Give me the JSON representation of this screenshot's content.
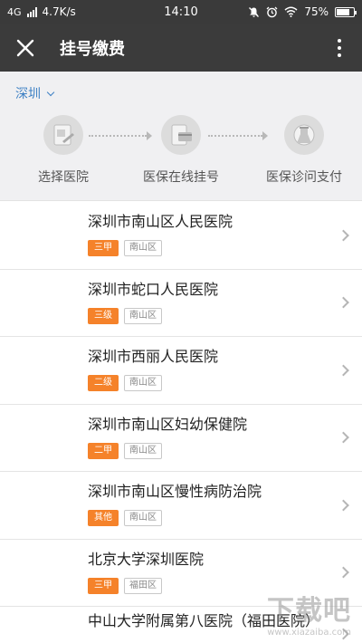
{
  "status": {
    "network": "4G",
    "speed": "4.7K/s",
    "time": "14:10",
    "battery": "75%",
    "battery_level": 0.75
  },
  "header": {
    "title": "挂号缴费",
    "close_icon": "close-icon",
    "more_icon": "more-vertical-icon"
  },
  "city": {
    "label": "深圳"
  },
  "steps": [
    {
      "label": "选择医院",
      "icon": "hospital-card-icon"
    },
    {
      "label": "医保在线挂号",
      "icon": "insurance-card-icon"
    },
    {
      "label": "医保诊问支付",
      "icon": "payment-flask-icon"
    }
  ],
  "hospitals": [
    {
      "name": "深圳市南山区人民医院",
      "level": "三甲",
      "district": "南山区"
    },
    {
      "name": "深圳市蛇口人民医院",
      "level": "三级",
      "district": "南山区"
    },
    {
      "name": "深圳市西丽人民医院",
      "level": "二级",
      "district": "南山区"
    },
    {
      "name": "深圳市南山区妇幼保健院",
      "level": "二甲",
      "district": "南山区"
    },
    {
      "name": "深圳市南山区慢性病防治院",
      "level": "其他",
      "district": "南山区"
    },
    {
      "name": "北京大学深圳医院",
      "level": "三甲",
      "district": "福田区"
    },
    {
      "name": "中山大学附属第八医院（福田医院）"
    }
  ],
  "watermark": {
    "big": "下载吧",
    "small": "www.xiazaiba.com"
  },
  "colors": {
    "accent": "#f5822a",
    "link": "#3d80c4",
    "titlebar": "#3b3b3b"
  }
}
